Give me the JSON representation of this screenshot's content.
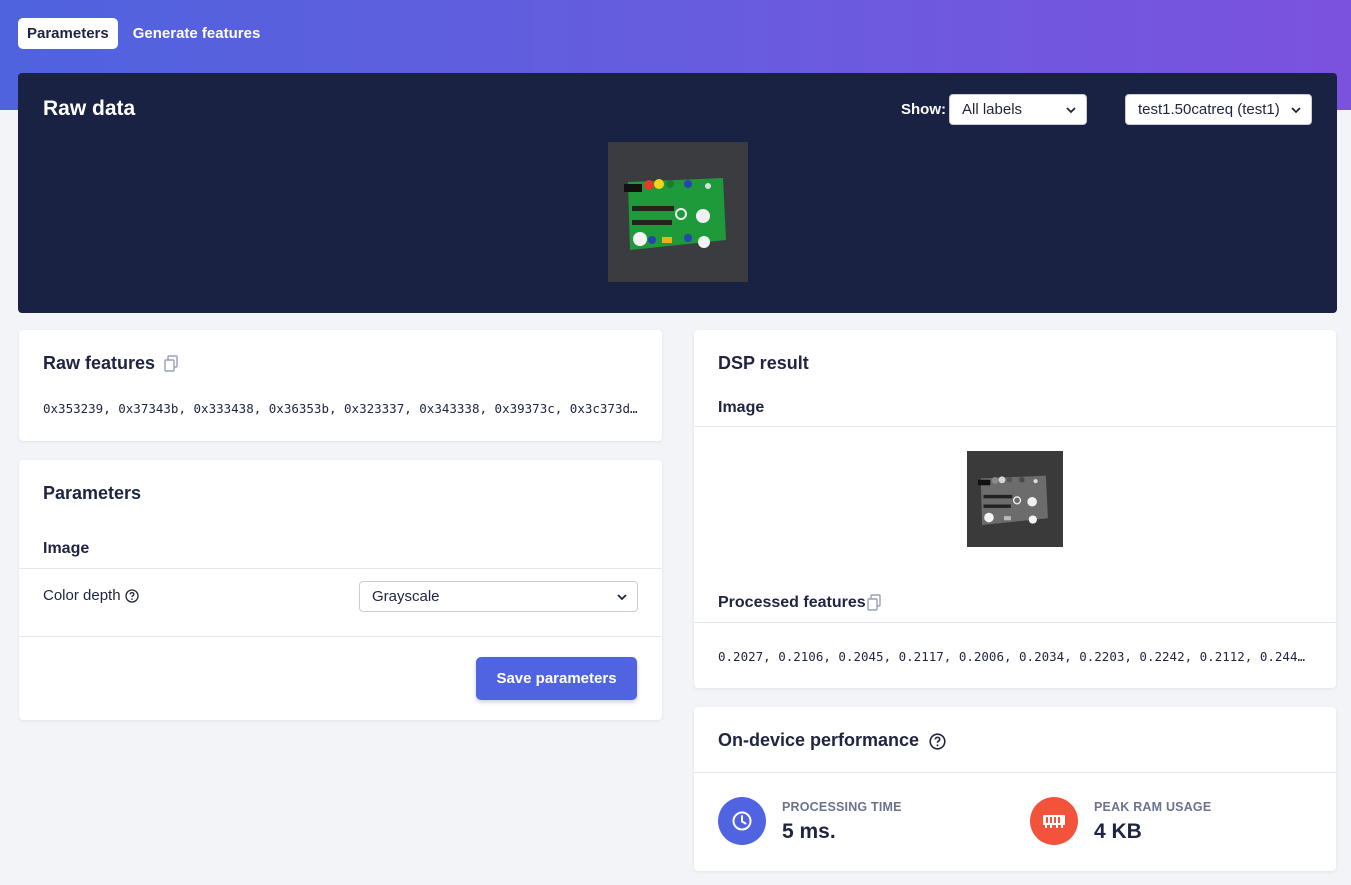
{
  "tabs": [
    {
      "label": "Parameters",
      "active": true
    },
    {
      "label": "Generate features",
      "active": false
    }
  ],
  "raw_data": {
    "title": "Raw data",
    "show_label": "Show:",
    "show_select": {
      "value": "All labels"
    },
    "sample_select": {
      "value": "test1.50catreq (test1)"
    }
  },
  "raw_features": {
    "title": "Raw features",
    "values_text": "0x353239, 0x37343b, 0x333438, 0x36353b, 0x323337, 0x343338, 0x39373c, 0x3c373d, 0x…"
  },
  "parameters": {
    "title": "Parameters",
    "section": "Image",
    "color_depth_label": "Color depth",
    "color_depth_value": "Grayscale",
    "save_label": "Save parameters"
  },
  "dsp_result": {
    "title": "DSP result",
    "image_section": "Image",
    "processed_title": "Processed features",
    "processed_text": "0.2027, 0.2106, 0.2045, 0.2117, 0.2006, 0.2034, 0.2203, 0.2242, 0.2112, 0.2445, 0.…"
  },
  "performance": {
    "title": "On-device performance",
    "processing_label": "PROCESSING TIME",
    "processing_value": "5 ms.",
    "ram_label": "PEAK RAM USAGE",
    "ram_value": "4 KB"
  },
  "colors": {
    "accent": "#5064e2",
    "dark_panel": "#1a2244",
    "ram_icon_bg": "#f4533b",
    "time_icon_bg": "#5064e2"
  },
  "icons": [
    "copy-icon",
    "help-icon",
    "clock-icon",
    "memory-icon",
    "chevron-down-icon"
  ]
}
